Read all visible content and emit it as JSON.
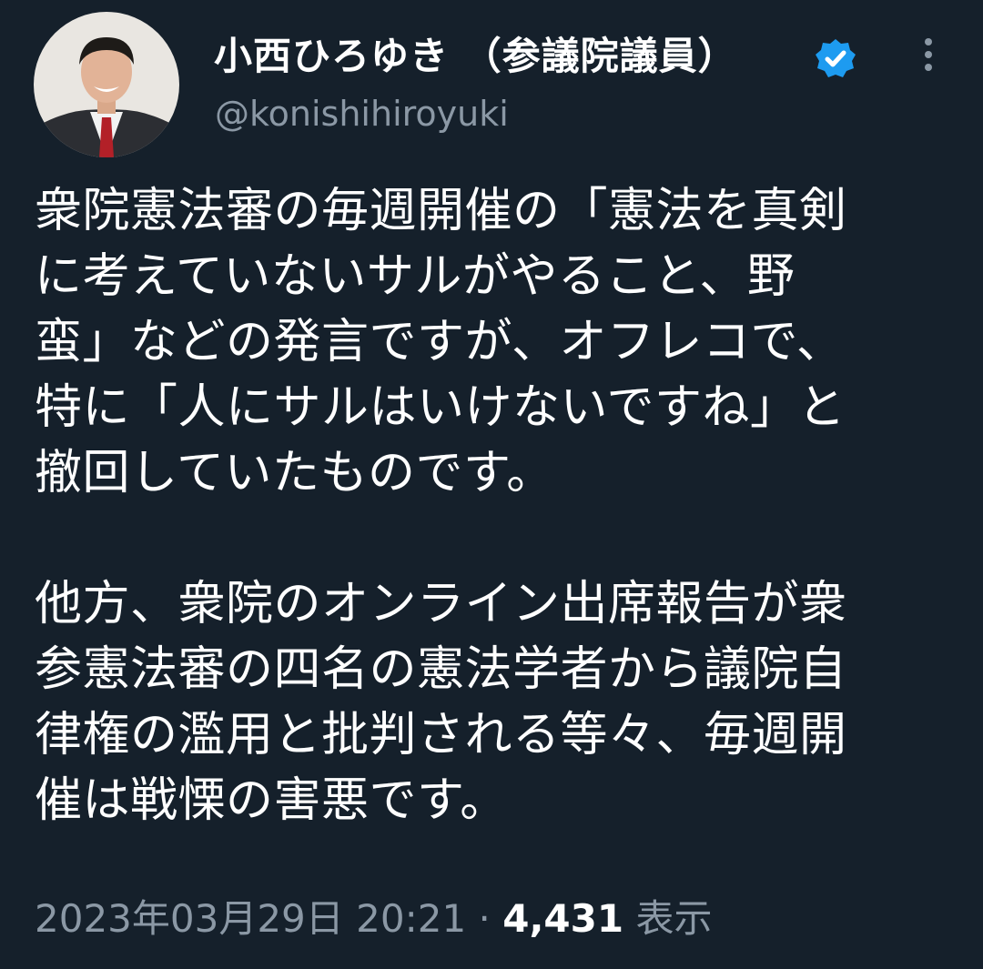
{
  "author": {
    "display_name": "小西ひろゆき （参議院議員）",
    "handle": "@konishihiroyuki",
    "verified": true,
    "verified_color": "#1d9bf0"
  },
  "icons": {
    "verified": "verified-badge-icon",
    "more": "more-vertical-icon"
  },
  "tweet": {
    "paragraphs": [
      {
        "lines": [
          "衆院憲法審の毎週開催の「憲法を真剣",
          "に考えていないサルがやること、野",
          "蛮」などの発言ですが、オフレコで、",
          "特に「人にサルはいけないですね」と",
          "撤回していたものです。"
        ]
      },
      {
        "lines": [
          "他方、衆院のオンライン出席報告が衆",
          "参憲法審の四名の憲法学者から議院自",
          "律権の濫用と批判される等々、毎週開",
          "催は戦慄の害悪です。"
        ]
      }
    ]
  },
  "meta": {
    "datetime": "2023年03月29日 20:21",
    "separator": "·",
    "views_count": "4,431",
    "views_label": "表示"
  },
  "colors": {
    "background": "#15202b",
    "text": "#ffffff",
    "secondary": "#8b98a5"
  }
}
